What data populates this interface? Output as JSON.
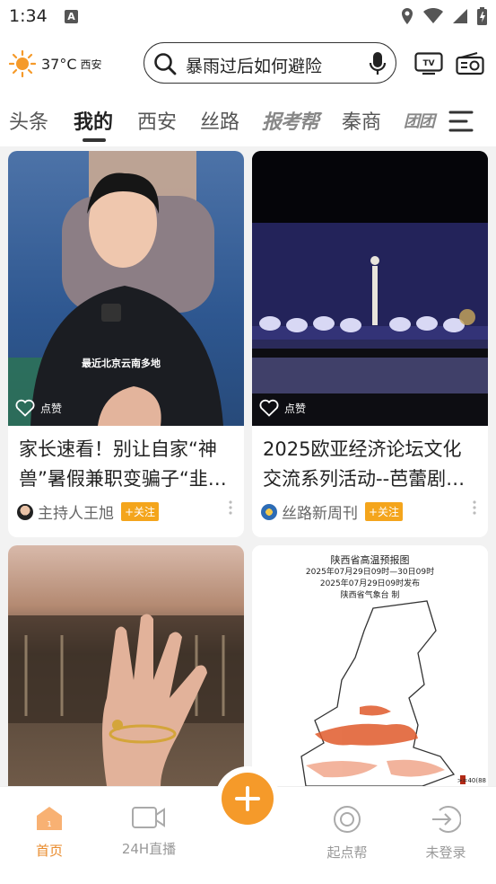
{
  "status_bar": {
    "time": "1:34",
    "a_badge": "A"
  },
  "header": {
    "temperature": "37°C",
    "city": "西安",
    "search_text": "暴雨过后如何避险"
  },
  "tabs": [
    {
      "label": "头条"
    },
    {
      "label": "我的"
    },
    {
      "label": "西安"
    },
    {
      "label": "丝路"
    },
    {
      "label": "报考帮"
    },
    {
      "label": "秦商"
    },
    {
      "label": "团团"
    }
  ],
  "cards": [
    {
      "title": "家长速看！别让自家“神兽”暑假兼职变骗子“韭…",
      "author": "主持人王旭",
      "follow": "+关注",
      "like": "点赞",
      "overlay_caption": "最近北京云南多地"
    },
    {
      "title": "2025欧亚经济论坛文化交流系列活动--芭蕾剧…",
      "author": "丝路新周刊",
      "follow": "+关注",
      "like": "点赞"
    },
    {
      "title": ""
    },
    {
      "map_title": "陕西省高温预报图",
      "map_line1": "2025年07月29日09时—30日09时",
      "map_line2": "2025年07月29日09时发布",
      "map_line3": "陕西省气象台 制",
      "legend": ">=40(88"
    }
  ],
  "bottom_nav": [
    {
      "label": "首页"
    },
    {
      "label": "24H直播"
    },
    {
      "label": "起点帮"
    },
    {
      "label": "未登录"
    }
  ],
  "colors": {
    "accent": "#f59a2a",
    "follow": "#f4a51c"
  }
}
